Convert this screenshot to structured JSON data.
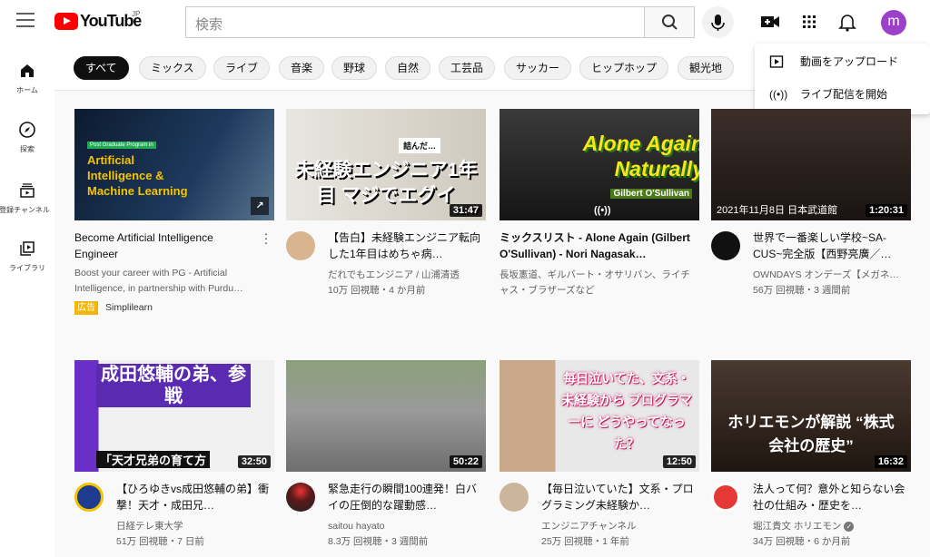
{
  "header": {
    "logo": "YouTube",
    "region": "JP",
    "search_placeholder": "検索",
    "avatar_letter": "m"
  },
  "sidebar": {
    "items": [
      {
        "label": "ホーム",
        "icon": "home-icon"
      },
      {
        "label": "探索",
        "icon": "compass-icon"
      },
      {
        "label": "登録チャンネル",
        "icon": "subscriptions-icon"
      },
      {
        "label": "ライブラリ",
        "icon": "library-icon"
      }
    ]
  },
  "chips": [
    "すべて",
    "ミックス",
    "ライブ",
    "音楽",
    "野球",
    "自然",
    "工芸品",
    "サッカー",
    "ヒップホップ",
    "観光地"
  ],
  "create_menu": {
    "items": [
      {
        "label": "動画をアップロード",
        "icon": "upload-video-icon"
      },
      {
        "label": "ライブ配信を開始",
        "icon": "live-icon"
      }
    ]
  },
  "colors": {
    "brand": "#ff0000",
    "ad_badge": "#f2b705",
    "avatar": "#9c3fc9"
  },
  "videos": [
    {
      "title": "Become Artificial Intelligence Engineer",
      "desc": "Boost your career with PG - Artificial Intelligence, in partnership with Purdu…",
      "ad_label": "広告",
      "channel": "Simplilearn",
      "thumb_text": "Artificial Intelligence & Machine Learning",
      "thumb_small": "Post Graduate Program in"
    },
    {
      "title": "【告白】未経験エンジニア転向した1年目はめちゃ病…",
      "channel": "だれでもエンジニア / 山浦清透",
      "stats": "10万 回視聴・4 か月前",
      "duration": "31:47",
      "thumb_text": "未経験エンジニア1年目 マジでエグイ",
      "thumb_small": "詰んだ…"
    },
    {
      "title": "ミックスリスト - Alone Again (Gilbert O'Sullivan) - Nori Nagasak…",
      "channel": "長坂憲道、ギルバート・オサリバン、ライチャス・ブラザーズなど",
      "thumb_text": "Alone Again Naturally",
      "thumb_small": "Gilbert O'Sullivan"
    },
    {
      "title": "世界で一番楽しい学校~SA-CUS~完全版【西野亮廣／…",
      "channel": "OWNDAYS オンデーズ【メガネ…",
      "stats": "56万 回視聴・3 週間前",
      "duration": "1:20:31",
      "thumb_text": "2021年11月8日 日本武道館"
    },
    {
      "title": "【ひろゆきvs成田悠輔の弟】衝撃！天才・成田兄…",
      "channel": "日経テレ東大学",
      "stats": "51万 回視聴・7 日前",
      "duration": "32:50",
      "thumb_text": "成田悠輔の弟、参戦",
      "thumb_small": "「天才兄弟の育て方"
    },
    {
      "title": "緊急走行の瞬間100連発！白バイの圧倒的な躍動感…",
      "channel": "saitou hayato",
      "stats": "8.3万 回視聴・3 週間前",
      "duration": "50:22"
    },
    {
      "title": "【毎日泣いていた】文系・プログラミング未経験か…",
      "channel": "エンジニアチャンネル",
      "stats": "25万 回視聴・1 年前",
      "duration": "12:50",
      "thumb_text": "毎日泣いてた、文系・未経験から プログラマーに どうやってなった？"
    },
    {
      "title": "法人って何？意外と知らない会社の仕組み・歴史を…",
      "channel": "堀江貴文 ホリエモン",
      "stats": "34万 回視聴・6 か月前",
      "duration": "16:32",
      "thumb_text": "ホリエモンが解説 “株式会社の歴史”",
      "verified": true
    }
  ]
}
